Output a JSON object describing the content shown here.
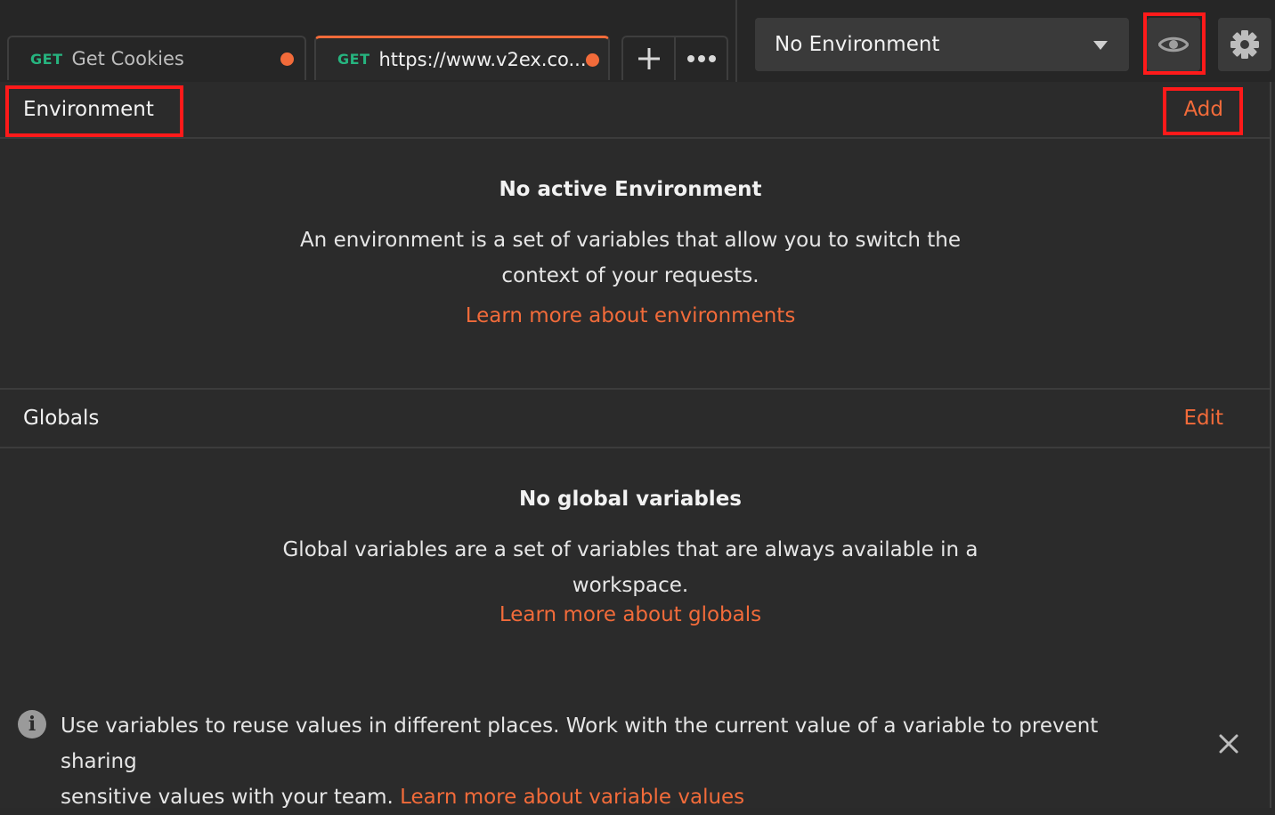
{
  "tabs": [
    {
      "method": "GET",
      "name": "Get Cookies",
      "unsaved": true,
      "active": false
    },
    {
      "method": "GET",
      "name": "https://www.v2ex.co...",
      "unsaved": true,
      "active": true
    }
  ],
  "tab_actions": {
    "new_tab_icon": "plus-icon",
    "more_icon": "ellipsis-icon"
  },
  "environment_selector": {
    "selected": "No Environment"
  },
  "toolbar_icons": {
    "quick_look": "eye-icon",
    "settings": "gear-icon"
  },
  "environment_section": {
    "title": "Environment",
    "action": "Add",
    "empty_heading": "No active Environment",
    "empty_desc_line1": "An environment is a set of variables that allow you to switch the",
    "empty_desc_line2": "context of your requests.",
    "learn_more": "Learn more about environments"
  },
  "globals_section": {
    "title": "Globals",
    "action": "Edit",
    "empty_heading": "No global variables",
    "empty_desc_line1": "Global variables are a set of variables that are always available in a",
    "empty_desc_line2": "workspace.",
    "learn_more": "Learn more about globals"
  },
  "info_banner": {
    "text_line1": "Use variables to reuse values in different places. Work with the current value of a variable to prevent sharing",
    "text_line2": "sensitive values with your team.",
    "link": "Learn more about variable values",
    "icon": "info-icon",
    "close_icon": "close-icon"
  },
  "colors": {
    "accent": "#f26b3a",
    "method_get": "#26b47f",
    "highlight": "#ff1a1a"
  }
}
